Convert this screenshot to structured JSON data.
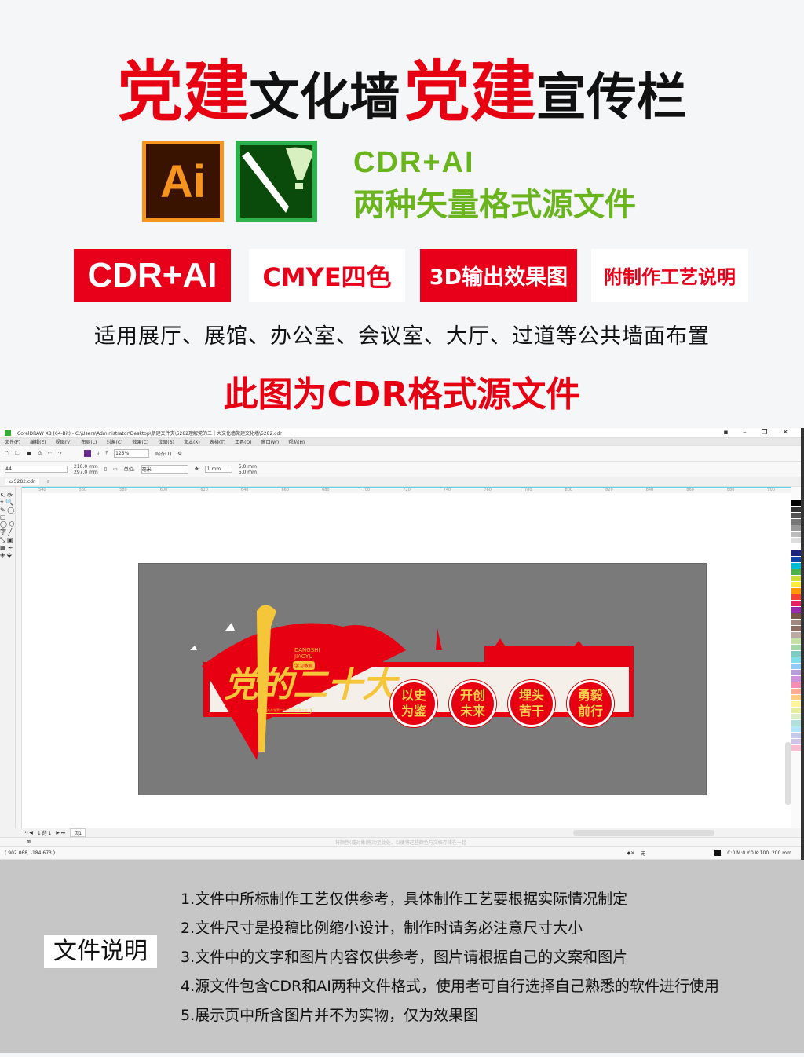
{
  "header": {
    "title_red1": "党建",
    "title_black1": "文化墙",
    "title_red2": "党建",
    "title_black2": "宣传栏"
  },
  "formats": {
    "ai_logo": "Ai",
    "line1": "CDR+AI",
    "line2": "两种矢量格式源文件"
  },
  "tags": [
    "CDR+AI",
    "CMYE四色",
    "3D输出效果图",
    "附制作工艺说明"
  ],
  "usage": "适用展厅、展馆、办公室、会议室、大厅、过道等公共墙面布置",
  "note": "此图为CDR格式源文件",
  "app": {
    "title": "CorelDRAW X8 (64-Bit) - C:\\Users\\Administrator\\Desktop\\新建文件夹\\5282理解党的二十大文化墙党建文化墙\\5282.cdr",
    "menu": [
      "文件(F)",
      "编辑(E)",
      "视图(V)",
      "布局(L)",
      "对象(C)",
      "效果(C)",
      "位图(B)",
      "文本(X)",
      "表格(T)",
      "工具(O)",
      "窗口(W)",
      "帮助(H)"
    ],
    "zoom": "125%",
    "snap": "贴齐(T)",
    "page_size": "A4",
    "width": "210.0 mm",
    "height": "297.0 mm",
    "unit_label": "单位:",
    "unit": "毫米",
    "nudge": ".1 mm",
    "dup_x": "5.0 mm",
    "dup_y": "5.0 mm",
    "doc_tab": "5282.cdr",
    "ruler": [
      "540",
      "560",
      "580",
      "600",
      "620",
      "640",
      "660",
      "680",
      "700",
      "720",
      "740",
      "760",
      "780",
      "800",
      "820",
      "840",
      "860",
      "880",
      "900"
    ],
    "page_nav": "1 的 1",
    "page_tab": "页1",
    "hint": "将颜色(或对象)拖动至此处，以便将这些颜色与文档存储在一起",
    "coords": "( 902.068, -184.673 )",
    "fill_none": "无",
    "color_info": "C:0 M:0 Y:0 K:100  .200 mm",
    "palette": [
      "#000000",
      "#333333",
      "#555555",
      "#777777",
      "#999999",
      "#bbbbbb",
      "#dddddd",
      "#ffffff",
      "#1a237e",
      "#0d47a1",
      "#00bcd4",
      "#4caf50",
      "#cddc39",
      "#ffeb3b",
      "#ff9800",
      "#f44336",
      "#e91e63",
      "#9c27b0",
      "#795548",
      "#a1887f",
      "#8d6e63",
      "#bcaaa4",
      "#c5e1a5",
      "#a5d6a7",
      "#80cbc4",
      "#80deea",
      "#90caf9",
      "#b39ddb",
      "#ce93d8",
      "#f48fb1",
      "#ffab91",
      "#ffcc80",
      "#fff59d",
      "#e6ee9c",
      "#dcedc8",
      "#b2dfdb",
      "#b3e5fc",
      "#c5cae9",
      "#d1c4e9",
      "#f8bbd0"
    ]
  },
  "artwork": {
    "title": "党的二十大",
    "pinyin1": "DANGSHI",
    "pinyin2": "JIAOYU",
    "badge": "学习教育",
    "subtitle": "中国共产党第二十次全国代表大会",
    "slogans": [
      [
        "以史",
        "为鉴"
      ],
      [
        "开创",
        "未来"
      ],
      [
        "埋头",
        "苦干"
      ],
      [
        "勇毅",
        "前行"
      ]
    ]
  },
  "file_notes": {
    "label": "文件说明",
    "items": [
      "1.文件中所标制作工艺仅供参考，具体制作工艺要根据实际情况制定",
      "2.文件尺寸是投稿比例缩小设计，制作时请务必注意尺寸大小",
      "3.文件中的文字和图片内容仅供参考，图片请根据自己的文案和图片",
      "4.源文件包含CDR和AI两种文件格式，使用者可自行选择自己熟悉的软件进行使用",
      "5.展示页中所含图片并不为实物，仅为效果图"
    ]
  }
}
